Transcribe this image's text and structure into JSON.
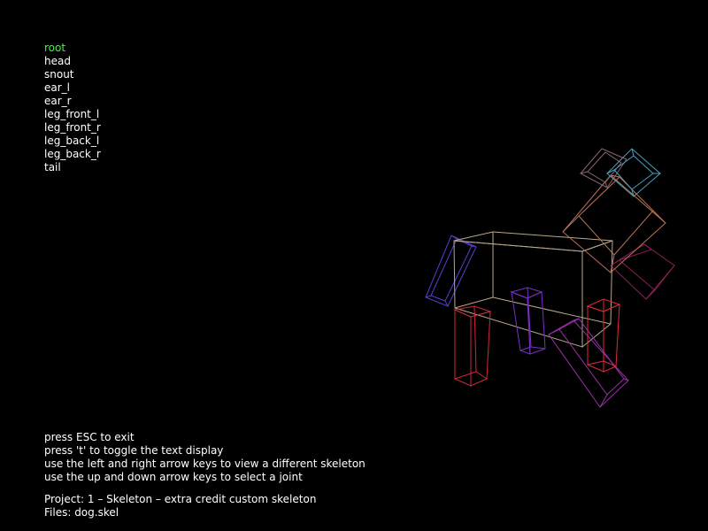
{
  "joints": [
    "root",
    "head",
    "snout",
    "ear_l",
    "ear_r",
    "leg_front_l",
    "leg_front_r",
    "leg_back_l",
    "leg_back_r",
    "tail"
  ],
  "selected_joint_index": 0,
  "help": {
    "line1": "press ESC to exit",
    "line2": "press 't' to toggle the text display",
    "line3": "use the left and right arrow keys to view a different skeleton",
    "line4": "use the up and down arrow keys to select a joint",
    "project": "Project: 1 – Skeleton – extra credit custom skeleton",
    "files": "Files: dog.skel"
  },
  "colors": {
    "background": "#000000",
    "text": "#ffffff",
    "selected_text": "#33ff33",
    "body": "#b8a88a",
    "head": "#b8745a",
    "snout": "#8b1f54",
    "ear": "#4aa0c0",
    "ear_dark": "#8a6470",
    "leg_front": "#cc2a3a",
    "leg_back": "#7b2fc8",
    "tail": "#5a3cd0"
  }
}
